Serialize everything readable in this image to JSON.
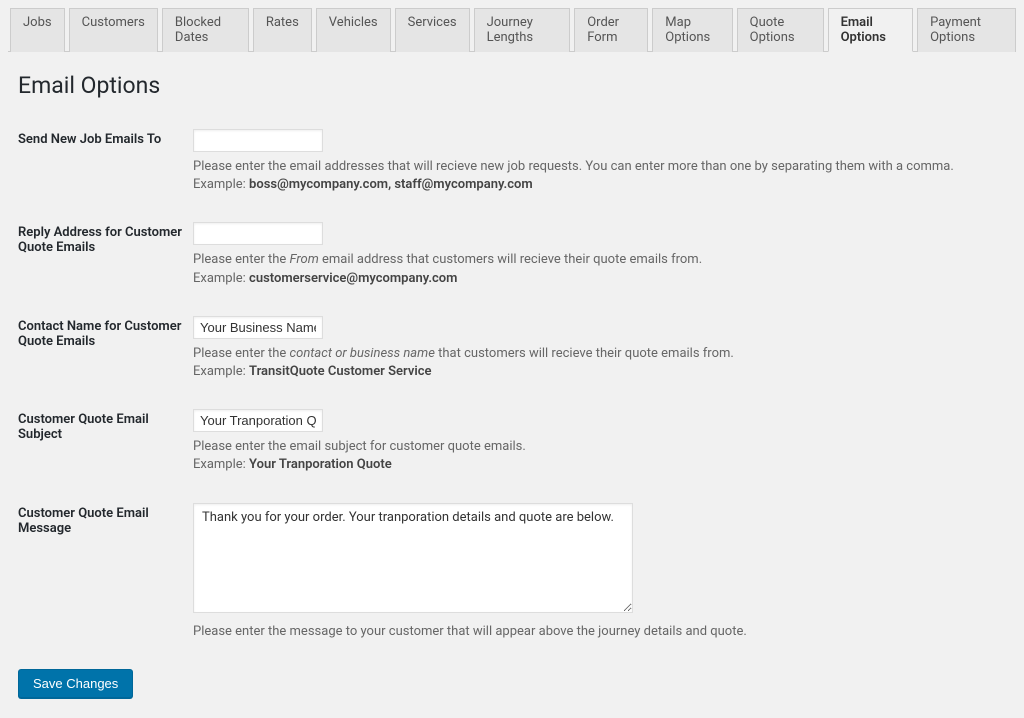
{
  "tabs": {
    "items": [
      {
        "label": "Jobs",
        "active": false
      },
      {
        "label": "Customers",
        "active": false
      },
      {
        "label": "Blocked Dates",
        "active": false
      },
      {
        "label": "Rates",
        "active": false
      },
      {
        "label": "Vehicles",
        "active": false
      },
      {
        "label": "Services",
        "active": false
      },
      {
        "label": "Journey Lengths",
        "active": false
      },
      {
        "label": "Order Form",
        "active": false
      },
      {
        "label": "Map Options",
        "active": false
      },
      {
        "label": "Quote Options",
        "active": false
      },
      {
        "label": "Email Options",
        "active": true
      },
      {
        "label": "Payment Options",
        "active": false
      }
    ]
  },
  "page": {
    "title": "Email Options"
  },
  "fields": {
    "new_job_emails": {
      "label": "Send New Job Emails To",
      "value": "",
      "desc_prefix": "Please enter the email addresses that will recieve new job requests. You can enter more than one by separating them with a comma.",
      "example_label": "Example: ",
      "example_value": "boss@mycompany.com, staff@mycompany.com"
    },
    "reply_address": {
      "label": "Reply Address for Customer Quote Emails",
      "value": "",
      "desc_prefix": "Please enter the ",
      "desc_em": "From",
      "desc_suffix": " email address that customers will recieve their quote emails from.",
      "example_label": "Example: ",
      "example_value": "customerservice@mycompany.com"
    },
    "contact_name": {
      "label": "Contact Name for Customer Quote Emails",
      "value": "Your Business Name",
      "desc_prefix": "Please enter the ",
      "desc_em": "contact or business name",
      "desc_suffix": " that customers will recieve their quote emails from.",
      "example_label": "Example: ",
      "example_value": "TransitQuote Customer Service"
    },
    "email_subject": {
      "label": "Customer Quote Email Subject",
      "value": "Your Tranporation Quote",
      "desc_prefix": "Please enter the email subject for customer quote emails.",
      "example_label": "Example: ",
      "example_value": "Your Tranporation Quote"
    },
    "email_message": {
      "label": "Customer Quote Email Message",
      "value": "Thank you for your order. Your tranporation details and quote are below.",
      "desc_prefix": "Please enter the message to your customer that will appear above the journey details and quote."
    }
  },
  "buttons": {
    "save": "Save Changes"
  }
}
